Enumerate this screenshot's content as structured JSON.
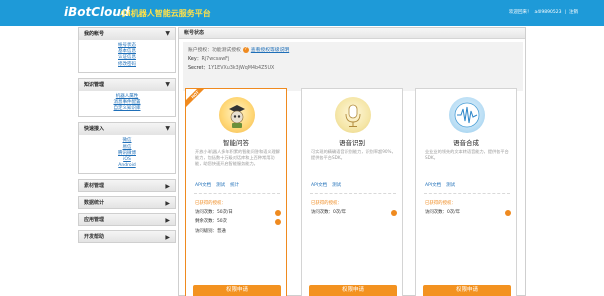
{
  "header": {
    "logo": "iBotCloud",
    "tagline": "小i机器人智能云服务平台",
    "welcome": "欢迎回来！",
    "user": "a4l9890523",
    "sep": "|",
    "logout": "注销"
  },
  "sidebar": {
    "sections": [
      {
        "title": "我的帐号",
        "links": [
          "帐号状态",
          "基本信息",
          "认证信息",
          "修改密码"
        ]
      },
      {
        "title": "知识管理",
        "links": [
          "机器人属性",
          "消息事件配置",
          "自定义知识库"
        ]
      },
      {
        "title": "快速接入",
        "links": [
          "微信",
          "易信",
          "腾讯微博",
          "iOS",
          "Android"
        ]
      }
    ],
    "collapsed": [
      "素材管理",
      "数据统计",
      "应用管理",
      "开发帮助"
    ]
  },
  "main": {
    "heading": "帐号状态",
    "account_label": "账户授权：",
    "account_value": "功能测试授权",
    "account_link": "查看授权等级说明",
    "key_label": "Key：",
    "key_value": "Rj7wcsawFj",
    "secret_label": "Secret：",
    "secret_value": "1Y1EVXu3k3jWqM4b4Z5UX"
  },
  "cards": [
    {
      "hot": "HOT",
      "title": "智能问答",
      "icon": "graduate-robot-icon",
      "desc": "开放小i机器人多年积累的智能问答和语义理解能力，包括数十万级对话库和上百种常用功能，助您快速开启智能服务能力。",
      "links": [
        "API文档",
        "测试",
        "统计"
      ],
      "stats_title": "已获得的授权：",
      "stats": [
        "访问次数：50次/日",
        "剩余次数：50次",
        "访问级别：普通"
      ],
      "button": "权限申请"
    },
    {
      "title": "语音识别",
      "icon": "microphone-icon",
      "desc": "可实现的精确语音识别能力，识别率超90%，提供各平台SDK。",
      "links": [
        "API文档",
        "测试"
      ],
      "stats_title": "已获得的授权：",
      "stats": [
        "访问次数：0次/年"
      ],
      "button": "权限申请"
    },
    {
      "title": "语音合成",
      "icon": "waveform-icon",
      "desc": "业业业的领先的文本转语音能力，提供各平台SDK。",
      "links": [
        "API文档",
        "测试"
      ],
      "stats_title": "已获得的授权：",
      "stats": [
        "访问次数：0次/年"
      ],
      "button": "权限申请"
    }
  ],
  "colors": {
    "header": "#1e9ad8",
    "accent": "#f39220",
    "link": "#1f6fb8"
  }
}
